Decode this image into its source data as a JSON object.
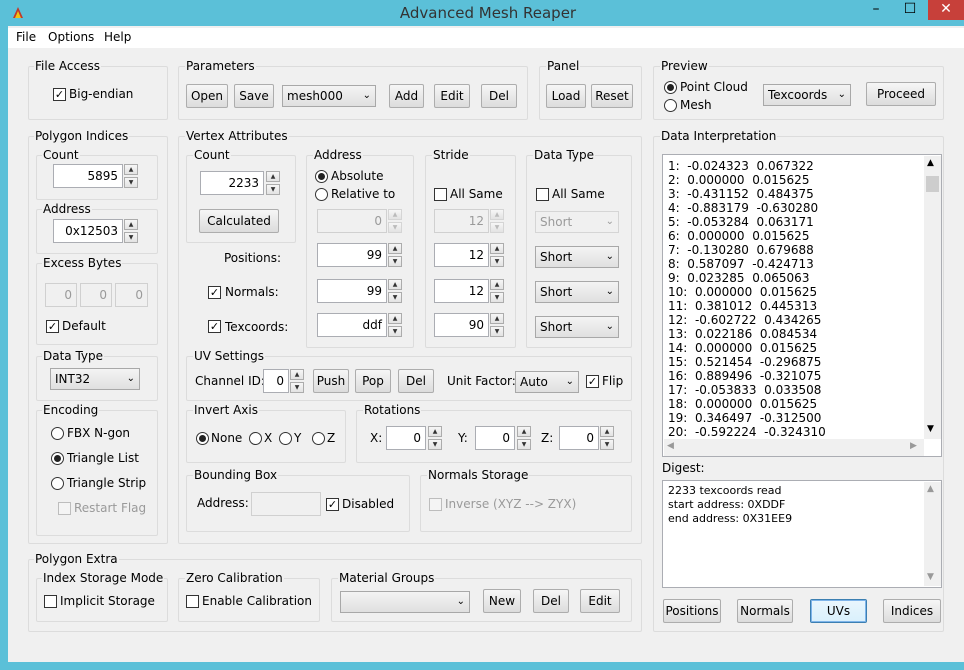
{
  "window": {
    "title": "Advanced Mesh Reaper",
    "min": "–",
    "max": "☐",
    "close": "✕"
  },
  "menu": {
    "file": "File",
    "options": "Options",
    "help": "Help"
  },
  "file_access": {
    "title": "File Access",
    "big_endian": "Big-endian",
    "big_endian_checked": true
  },
  "parameters": {
    "title": "Parameters",
    "open": "Open",
    "save": "Save",
    "mesh": "mesh000",
    "add": "Add",
    "edit": "Edit",
    "del": "Del"
  },
  "panel": {
    "title": "Panel",
    "load": "Load",
    "reset": "Reset"
  },
  "preview": {
    "title": "Preview",
    "point_cloud": "Point Cloud",
    "mesh": "Mesh",
    "mode": "Texcoords",
    "proceed": "Proceed"
  },
  "polygon_indices": {
    "title": "Polygon Indices",
    "count_label": "Count",
    "count": "5895",
    "address_label": "Address",
    "address": "0x12503",
    "excess_label": "Excess Bytes",
    "excess": [
      "0",
      "0",
      "0"
    ],
    "default": "Default",
    "data_type_label": "Data Type",
    "data_type": "INT32",
    "encoding_label": "Encoding",
    "fbx": "FBX N-gon",
    "tri_list": "Triangle List",
    "tri_strip": "Triangle Strip",
    "restart": "Restart Flag"
  },
  "vertex": {
    "title": "Vertex Attributes",
    "count_label": "Count",
    "count": "2233",
    "calculated": "Calculated",
    "positions": "Positions:",
    "normals": "Normals:",
    "texcoords": "Texcoords:",
    "address_label": "Address",
    "absolute": "Absolute",
    "relative": "Relative to",
    "relative_val": "0",
    "addr_pos": "99",
    "addr_norm": "99",
    "addr_tex": "ddf",
    "stride_label": "Stride",
    "stride_all_same": "All Same",
    "stride_same_val": "12",
    "stride_pos": "12",
    "stride_norm": "12",
    "stride_tex": "90",
    "dtype_label": "Data Type",
    "dtype_all_same": "All Same",
    "dtype_same_val": "Short",
    "dtype_pos": "Short",
    "dtype_norm": "Short",
    "dtype_tex": "Short"
  },
  "uv": {
    "title": "UV Settings",
    "channel_label": "Channel ID:",
    "channel": "0",
    "push": "Push",
    "pop": "Pop",
    "del": "Del",
    "unit_label": "Unit Factor:",
    "unit": "Auto",
    "flip": "Flip"
  },
  "invert": {
    "title": "Invert Axis",
    "none": "None",
    "x": "X",
    "y": "Y",
    "z": "Z"
  },
  "rotations": {
    "title": "Rotations",
    "x_label": "X:",
    "x": "0",
    "y_label": "Y:",
    "y": "0",
    "z_label": "Z:",
    "z": "0"
  },
  "bbox": {
    "title": "Bounding Box",
    "address_label": "Address:",
    "disabled": "Disabled"
  },
  "normals_storage": {
    "title": "Normals Storage",
    "inverse": "Inverse (XYZ --> ZYX)"
  },
  "polygon_extra": {
    "title": "Polygon Extra",
    "index_mode": "Index Storage Mode",
    "implicit": "Implicit Storage",
    "zero": "Zero Calibration",
    "enable": "Enable Calibration",
    "material": "Material Groups",
    "new": "New",
    "del": "Del",
    "edit": "Edit"
  },
  "interp": {
    "title": "Data Interpretation",
    "rows": [
      "1:  -0.024323  0.067322",
      "2:  0.000000  0.015625",
      "3:  -0.431152  0.484375",
      "4:  -0.883179  -0.630280",
      "5:  -0.053284  0.063171",
      "6:  0.000000  0.015625",
      "7:  -0.130280  0.679688",
      "8:  0.587097  -0.424713",
      "9:  0.023285  0.065063",
      "10:  0.000000  0.015625",
      "11:  0.381012  0.445313",
      "12:  -0.602722  0.434265",
      "13:  0.022186  0.084534",
      "14:  0.000000  0.015625",
      "15:  0.521454  -0.296875",
      "16:  0.889496  -0.321075",
      "17:  -0.053833  0.033508",
      "18:  0.000000  0.015625",
      "19:  0.346497  -0.312500",
      "20:  -0.592224  -0.324310"
    ]
  },
  "digest": {
    "title": "Digest:",
    "lines": [
      "2233 texcoords read",
      "start address: 0XDDF",
      "end address: 0X31EE9"
    ]
  },
  "bottom": {
    "positions": "Positions",
    "normals": "Normals",
    "uvs": "UVs",
    "indices": "Indices"
  }
}
